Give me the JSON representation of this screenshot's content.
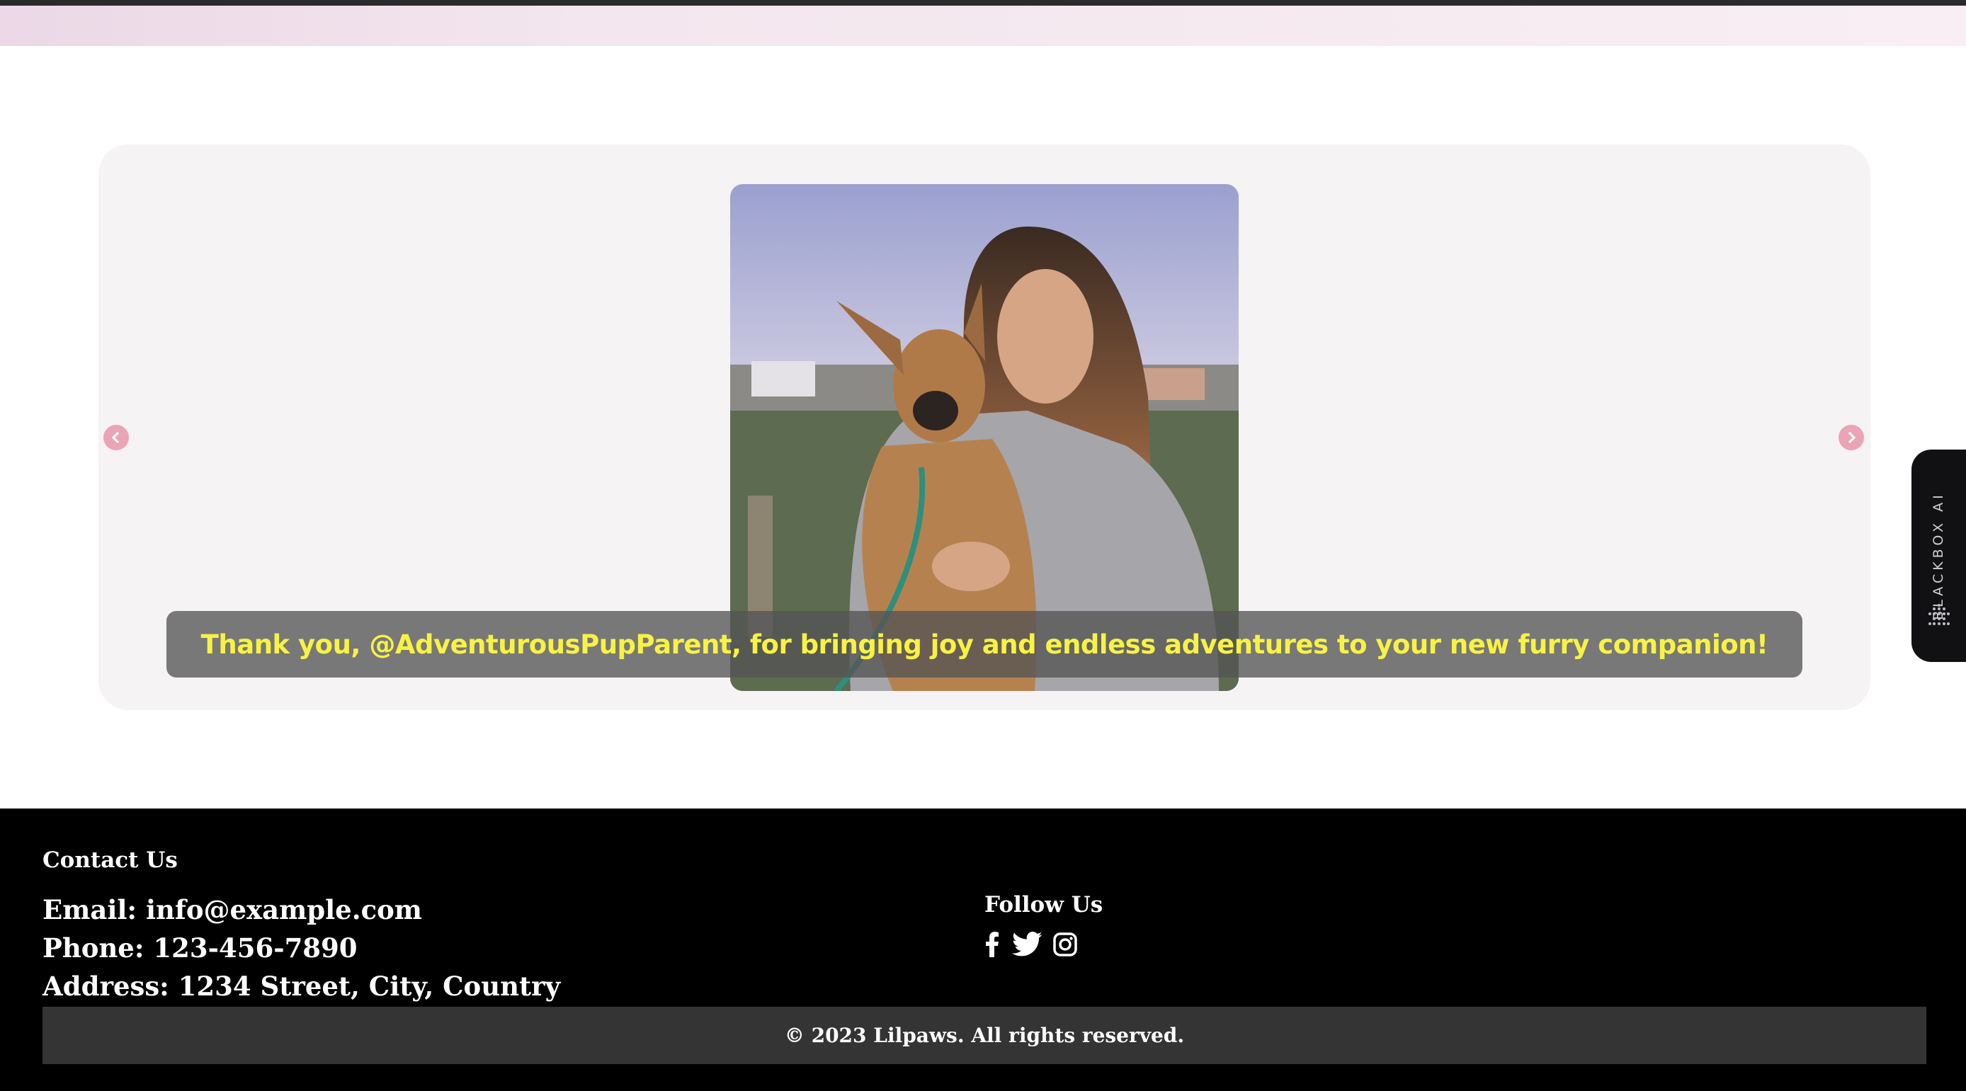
{
  "testimonial": {
    "caption": "Thank you, @AdventurousPupParent, for bringing joy and endless adventures to your new furry companion!",
    "image_subject": "woman hugging a brown dog outdoors"
  },
  "carousel": {
    "prev_icon": "chevron-left-icon",
    "next_icon": "chevron-right-icon",
    "arrow_color": "#eaa4b6"
  },
  "side_widget": {
    "label": "BLACKBOX AI"
  },
  "footer": {
    "contact_heading": "Contact Us",
    "email": "Email: info@example.com",
    "phone": "Phone: 123-456-7890",
    "address": "Address: 1234 Street, City, Country",
    "follow_heading": "Follow Us",
    "socials": [
      "facebook-icon",
      "twitter-icon",
      "instagram-icon"
    ],
    "copyright": "© 2023 Lilpaws. All rights reserved."
  },
  "colors": {
    "caption_text": "#f7f244",
    "footer_bg": "#000000",
    "copyright_bg": "#343434"
  }
}
